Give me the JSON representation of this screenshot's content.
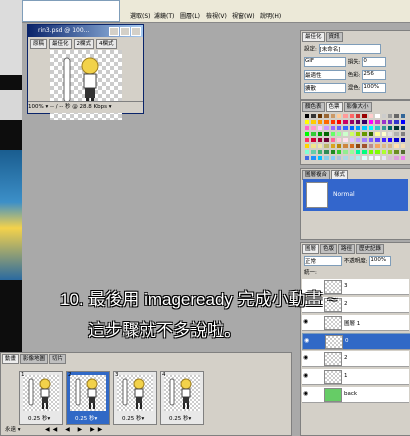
{
  "app": {
    "menu": [
      "視窗(W)",
      "說明(H)",
      "影像(I)",
      "圖層(L)",
      "選取(S)",
      "濾鏡(T)",
      "檢視(V)"
    ],
    "window_title": "rin3.psd @ 100…",
    "doc_tabs": [
      "原稿",
      "最佳化",
      "2欄式",
      "4欄式"
    ],
    "doc_status": "100% ▾ -- / -- 秒 @ 28.8 Kbps ▾"
  },
  "optimize": {
    "tabs": [
      "最佳化",
      "資訊"
    ],
    "setting_label": "設定:",
    "setting_value": "[未命名]",
    "format": "GIF",
    "algorithm": "最適性",
    "dither": "擴散",
    "lossy_label": "損失:",
    "lossy_value": "0",
    "colors_label": "色彩:",
    "colors_value": "256",
    "dither_pct_label": "混色:",
    "dither_pct_value": "100%"
  },
  "swatches_panel": {
    "tabs": [
      "顏色表",
      "色票",
      "影像大小"
    ],
    "colors": [
      "#000000",
      "#333333",
      "#663300",
      "#996633",
      "#cc9966",
      "#ffcc99",
      "#ff9999",
      "#ff6666",
      "#cc3333",
      "#990000",
      "#ffcccc",
      "#ffffff",
      "#cccccc",
      "#999999",
      "#666666",
      "#336699",
      "#ffff00",
      "#ffcc00",
      "#ff9900",
      "#ff6600",
      "#ff3300",
      "#ff0000",
      "#cc0066",
      "#990066",
      "#660066",
      "#330066",
      "#ff00ff",
      "#cc33cc",
      "#9933cc",
      "#6633cc",
      "#3333cc",
      "#0000ff",
      "#ff66cc",
      "#ff99cc",
      "#ffccff",
      "#cc99ff",
      "#9966ff",
      "#6666ff",
      "#3366ff",
      "#0066ff",
      "#0099ff",
      "#00ccff",
      "#00ffff",
      "#33cccc",
      "#339999",
      "#006666",
      "#003333",
      "#003366",
      "#00ff00",
      "#33cc33",
      "#009900",
      "#006600",
      "#66ff66",
      "#99ff99",
      "#ccffcc",
      "#ccff66",
      "#99cc00",
      "#669900",
      "#336600",
      "#ffff99",
      "#ffffcc",
      "#e0e0e0",
      "#b0b0b0",
      "#808080",
      "#ff3366",
      "#cc0033",
      "#990033",
      "#660033",
      "#ff6699",
      "#ffcce0",
      "#ffe0f0",
      "#e0c0ff",
      "#c0a0ff",
      "#a080ff",
      "#8060ff",
      "#6040ff",
      "#4020ff",
      "#2000ff",
      "#0000cc",
      "#000099",
      "#ffd700",
      "#f0e68c",
      "#eee8aa",
      "#bdb76b",
      "#daa520",
      "#b8860b",
      "#cd853f",
      "#d2691e",
      "#8b4513",
      "#a0522d",
      "#bc8f8f",
      "#f4a460",
      "#deb887",
      "#d2b48c",
      "#ffdead",
      "#f5deb3",
      "#7fffd4",
      "#66cdaa",
      "#3cb371",
      "#2e8b57",
      "#228b22",
      "#32cd32",
      "#90ee90",
      "#98fb98",
      "#00fa9a",
      "#00ff7f",
      "#7cfc00",
      "#7fff00",
      "#adff2f",
      "#9acd32",
      "#6b8e23",
      "#556b2f",
      "#4169e1",
      "#1e90ff",
      "#00bfff",
      "#87ceeb",
      "#87cefa",
      "#b0c4de",
      "#add8e6",
      "#b0e0e6",
      "#afeeee",
      "#e0ffff",
      "#f0f8ff",
      "#f8f8ff",
      "#e6e6fa",
      "#d8bfd8",
      "#dda0dd",
      "#ee82ee"
    ]
  },
  "styles_panel": {
    "tabs": [
      "圖層複合",
      "樣式"
    ],
    "selected_style": "Normal"
  },
  "layers_panel": {
    "tabs": [
      "圖層",
      "色版",
      "路徑",
      "歷史記錄"
    ],
    "mode": "正常",
    "opacity_label": "不透明度:",
    "opacity_value": "100%",
    "unify_label": "統一:",
    "layers": [
      {
        "name": "3",
        "visible": false,
        "selected": false
      },
      {
        "name": "2",
        "visible": false,
        "selected": false
      },
      {
        "name": "圖層 1",
        "visible": true,
        "selected": false
      },
      {
        "name": "0",
        "visible": true,
        "selected": true
      },
      {
        "name": "2",
        "visible": true,
        "selected": false
      },
      {
        "name": "1",
        "visible": true,
        "selected": false
      },
      {
        "name": "back",
        "visible": true,
        "selected": false
      }
    ]
  },
  "animation_panel": {
    "tabs": [
      "動畫",
      "影像地圖",
      "切片"
    ],
    "frames": [
      {
        "num": "1",
        "delay": "0.25 秒▾",
        "selected": false
      },
      {
        "num": "2",
        "delay": "0.25 秒▾",
        "selected": true
      },
      {
        "num": "3",
        "delay": "0.25 秒▾",
        "selected": false
      },
      {
        "num": "4",
        "delay": "0.25 秒▾",
        "selected": false
      }
    ],
    "loop": "永遠"
  },
  "caption": {
    "line1": "10. 最後用 imageready 完成小動畫 ~",
    "line2": "這步驟就不多說啦。"
  },
  "colors": {
    "workspace": "#a9a9a9",
    "panel": "#d4d0c8",
    "selection": "#3169c6",
    "back_layer": "#66cc66"
  }
}
